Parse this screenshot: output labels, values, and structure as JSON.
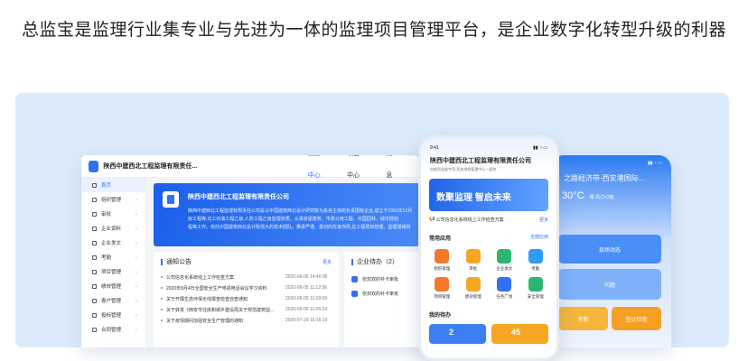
{
  "headline": "总监宝是监理行业集专业与先进为一体的监理项目管理平台，是企业数字化转型升级的利器",
  "desktop": {
    "company": "陕西中建西北工程监理有限责任...",
    "nav": [
      "企业中心",
      "项目中心",
      "消息",
      "我"
    ],
    "sidebar": [
      {
        "label": "首页",
        "arrow": ""
      },
      {
        "label": "组织管理",
        "arrow": "⌄"
      },
      {
        "label": "审批",
        "arrow": "⌄"
      },
      {
        "label": "企业资料",
        "arrow": "⌄"
      },
      {
        "label": "企业发文",
        "arrow": "⌄"
      },
      {
        "label": "考勤",
        "arrow": "⌄"
      },
      {
        "label": "项目管理",
        "arrow": "⌄"
      },
      {
        "label": "绩效管理",
        "arrow": "⌄"
      },
      {
        "label": "客户管理",
        "arrow": "⌄"
      },
      {
        "label": "投标管理",
        "arrow": "⌄"
      },
      {
        "label": "合同管理",
        "arrow": "⌄"
      }
    ],
    "banner": {
      "title": "陕西中建西北工程监理有限责任公司",
      "lines": [
        "陕西中建西北工程监理有限责任公司是以中国建筑西北设计研究院为投资主体的负责国有企业,成立于1991年12月",
        "房工程等,化工石油工程乙级,人防工程乙级监理资质。从事房屋建筑、市政公用工程、中国园林、城市规划",
        "程等工作。依托中国建筑西北设计院强大的技术团队。秉承严谨、勇创的优良作风,在工程项目管理、监理领域得"
      ]
    },
    "notice": {
      "title": "通知公告",
      "more": "更多",
      "items": [
        {
          "text": "公司信息化系统线上工作检查方案",
          "date": "2020-06-05 14:40:36"
        },
        {
          "text": "2020年8月4日全国安全生产电视电话会议学习资料",
          "date": "2020-06-05 11:12:36"
        },
        {
          "text": "关于开展生态环保无线报查检查自查通知",
          "date": "2020-06-05 11:09:09"
        },
        {
          "text": "关于转发《西安市住房和城乡建设局关于规范建筑监...",
          "date": "2020-06-05 11:06:24"
        },
        {
          "text": "关于疫情期间加强安全生产管理的通知",
          "date": "2020-07-29 15:16:19"
        }
      ]
    },
    "todo": {
      "title": "企业待办（2）",
      "items": [
        "张双双的补卡审批",
        "张双双的补卡审批"
      ]
    }
  },
  "phone": {
    "time": "9:41",
    "company": "陕西中建西北工程监理有限责任公司",
    "subtitle": "由陕西省委专项·西安地铁管理中心一组控",
    "banner": "数聚监理 智启未来",
    "note": "公司信息化系统线上工作检查方案",
    "note_more": "更多",
    "apps_title": "常用应用",
    "apps_more": "全部应用",
    "apps": [
      {
        "label": "组织管理",
        "color": "#f37a2b"
      },
      {
        "label": "审批",
        "color": "#f5a623"
      },
      {
        "label": "企业发文",
        "color": "#2bb673"
      },
      {
        "label": "考勤",
        "color": "#2f9cf5"
      },
      {
        "label": "项目管理",
        "color": "#f37a2b"
      },
      {
        "label": "绩效管理",
        "color": "#f5a623"
      },
      {
        "label": "任务广场",
        "color": "#2f72f5"
      },
      {
        "label": "安全管理",
        "color": "#2bb673"
      }
    ],
    "todo_title": "我的待办",
    "todo_counts": [
      "2",
      "45"
    ]
  },
  "phone2": {
    "signal": "▮▮ ◔ ▭",
    "title": "之路经济带·西安港国际...",
    "temp": "30°C",
    "weather": "晴  风力<3级",
    "tiles": [
      "现场动态",
      "问题",
      "考勤",
      "签达检查"
    ]
  }
}
